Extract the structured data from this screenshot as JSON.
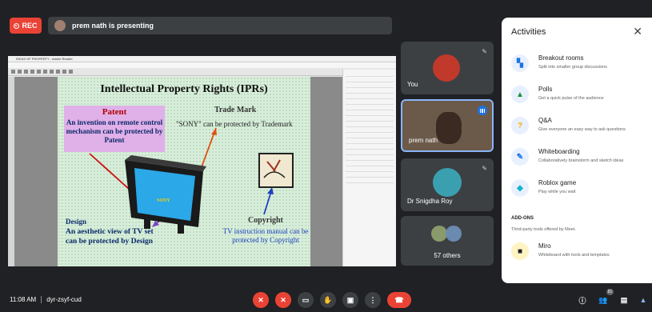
{
  "recording": {
    "label": "REC"
  },
  "presenting": {
    "text": "prem nath is presenting"
  },
  "shared_screen": {
    "app_title": "IDEAS OF PROPERTY - Adobe Reader",
    "slide": {
      "title": "Intellectual Property Rights (IPRs)",
      "patent_heading": "Patent",
      "patent_text": "An invention on remote control mechanism can be protected by Patent",
      "trademark_heading": "Trade Mark",
      "trademark_text": "\"SONY\" can be protected by Trademark",
      "tv_brand": "SONY",
      "design_heading": "Design",
      "design_text": "An aesthetic view of TV set can be protected by Design",
      "copyright_heading": "Copyright",
      "copyright_text": "TV instruction manual can be protected by Copyright"
    }
  },
  "participants": [
    {
      "name": "You",
      "avatar_color": "#c0392b"
    },
    {
      "name": "prem nath",
      "avatar_color": "#7a5a48",
      "speaking": true
    },
    {
      "name": "Dr Snigdha Roy",
      "avatar_color": "#3aa0b0"
    },
    {
      "name": "57 others"
    }
  ],
  "activities": {
    "title": "Activities",
    "items": [
      {
        "label": "Breakout rooms",
        "description": "Split into smaller group discussions",
        "icon": "breakout-rooms-icon",
        "color": "#1a73e8"
      },
      {
        "label": "Polls",
        "description": "Get a quick pulse of the audience",
        "icon": "polls-icon",
        "color": "#1e8e3e"
      },
      {
        "label": "Q&A",
        "description": "Give everyone an easy way to ask questions",
        "icon": "qa-icon",
        "color": "#f9ab00"
      },
      {
        "label": "Whiteboarding",
        "description": "Collaboratively brainstorm and sketch ideas",
        "icon": "whiteboard-icon",
        "color": "#1a73e8"
      },
      {
        "label": "Roblox game",
        "description": "Play while you wait",
        "icon": "game-icon",
        "color": "#12b5cb"
      }
    ],
    "addons_heading": "ADD-ONS",
    "addons_sub": "Third-party tools offered by Meet.",
    "addons": [
      {
        "label": "Miro",
        "description": "Whiteboard with tools and templates",
        "icon": "miro-icon",
        "color": "#ffd02f"
      }
    ]
  },
  "bottom_bar": {
    "time": "11:08 AM",
    "meeting_code": "dyr-zsyf-cud",
    "participant_count": "61"
  }
}
